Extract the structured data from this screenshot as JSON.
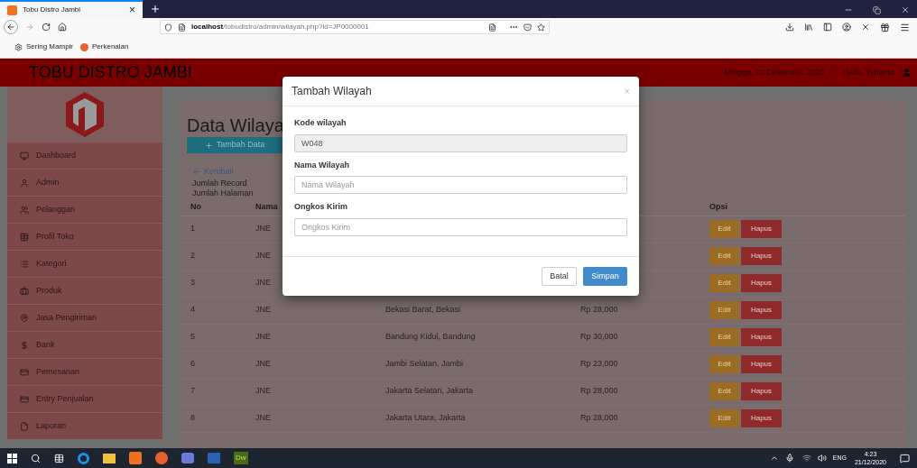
{
  "browser": {
    "tab": {
      "title": "Tobu Distro Jambi",
      "close": "×"
    },
    "url": "**localhost**/tobudistro/admin/wilayah.php?id=JP0000001",
    "bookmarks": [
      "Sering Mampir",
      "Perkenalan"
    ]
  },
  "header": {
    "brand": "TOBU DISTRO JAMBI",
    "date": "Minggu, 20 Desember 2020",
    "greeting": "Hallo, Yulianto"
  },
  "sidebar": {
    "items": [
      {
        "kind": "monitor",
        "label": "Dashboard"
      },
      {
        "kind": "user",
        "label": "Admin"
      },
      {
        "kind": "users",
        "label": "Pelanggan"
      },
      {
        "kind": "table",
        "label": "Profil Toko"
      },
      {
        "kind": "list",
        "label": "Kategori"
      },
      {
        "kind": "briefcase",
        "label": "Produk"
      },
      {
        "kind": "pin",
        "label": "Jasa Pengiriman"
      },
      {
        "kind": "dollar",
        "label": "Bank"
      },
      {
        "kind": "card",
        "label": "Pemesanan"
      },
      {
        "kind": "card",
        "label": "Entry Penjualan"
      },
      {
        "kind": "file",
        "label": "Laporan"
      }
    ]
  },
  "content": {
    "title": "Data Wilaya",
    "add_button": "Tambah Data",
    "back_link": "Kembali",
    "record_count_label": "Jumlah Record",
    "page_count_label": "Jumlah Halaman",
    "table": {
      "columns": [
        "No",
        "Nama",
        "",
        "",
        "Opsi"
      ],
      "rows": [
        {
          "no": "1",
          "name": "JNE",
          "region": "",
          "cost": "",
          "edit": "Edit",
          "delete": "Hapus"
        },
        {
          "no": "2",
          "name": "JNE",
          "region": "",
          "cost": "",
          "edit": "Edit",
          "delete": "Hapus"
        },
        {
          "no": "3",
          "name": "JNE",
          "region": "",
          "cost": "",
          "edit": "Edit",
          "delete": "Hapus"
        },
        {
          "no": "4",
          "name": "JNE",
          "region": "Bekasi Barat, Bekasi",
          "cost": "Rp 28,000",
          "edit": "Edit",
          "delete": "Hapus"
        },
        {
          "no": "5",
          "name": "JNE",
          "region": "Bandung Kidul, Bandung",
          "cost": "Rp 30,000",
          "edit": "Edit",
          "delete": "Hapus"
        },
        {
          "no": "6",
          "name": "JNE",
          "region": "Jambi Selatan, Jambi",
          "cost": "Rp 23,000",
          "edit": "Edit",
          "delete": "Hapus"
        },
        {
          "no": "7",
          "name": "JNE",
          "region": "Jakarta Selatan, Jakarta",
          "cost": "Rp 28,000",
          "edit": "Edit",
          "delete": "Hapus"
        },
        {
          "no": "8",
          "name": "JNE",
          "region": "Jakarta Utara, Jakarta",
          "cost": "Rp 28,000",
          "edit": "Edit",
          "delete": "Hapus"
        }
      ]
    }
  },
  "modal": {
    "title": "Tambah Wilayah",
    "close": "×",
    "fields": [
      {
        "label": "Kode wilayah",
        "value": "W048",
        "disabled": true
      },
      {
        "label": "Nama Wilayah",
        "placeholder": "Nama Wilayah",
        "disabled": false
      },
      {
        "label": "Ongkos Kirim",
        "placeholder": "Ongkos Kirim",
        "disabled": false
      }
    ],
    "cancel": "Batal",
    "save": "Simpan"
  },
  "taskbar": {
    "dw_label": "Dw",
    "language": "ENG",
    "time": "4:23",
    "date": "21/12/2020"
  }
}
